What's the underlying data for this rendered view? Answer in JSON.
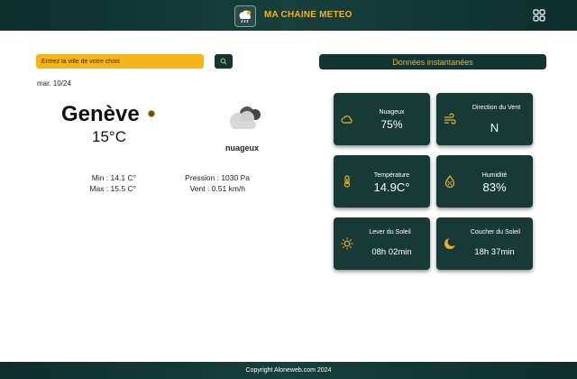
{
  "header": {
    "brand": "MA CHAINE METEO"
  },
  "search": {
    "placeholder": "Entrez la ville de votre choix"
  },
  "current": {
    "date": "mar. 10/24",
    "city": "Genève",
    "temperature": "15°C",
    "condition": "nuageux",
    "min": "Min : 14.1 C°",
    "max": "Max : 15.5 C°",
    "pressure": "Pression : 1030 Pa",
    "wind": "Vent : 0.51 km/h"
  },
  "instant": {
    "title": "Données instantanées",
    "cards": [
      {
        "label": "Nuageux",
        "value": "75%",
        "icon": "cloud-icon"
      },
      {
        "label": "Direction du Vent",
        "value": "N",
        "icon": "wind-icon"
      },
      {
        "label": "Température",
        "value": "14.9C°",
        "icon": "thermometer-icon"
      },
      {
        "label": "Humidité",
        "value": "83%",
        "icon": "humidity-icon"
      },
      {
        "label": "Lever du Soleil",
        "value": "08h 02min",
        "icon": "sunrise-icon"
      },
      {
        "label": "Coucher du Soleil",
        "value": "18h 37min",
        "icon": "sunset-icon"
      }
    ]
  },
  "footer": {
    "text": "Copyright Aloneweb.com 2024"
  },
  "colors": {
    "accent": "#f2b01e",
    "dark": "#123532",
    "card": "#173a37"
  }
}
